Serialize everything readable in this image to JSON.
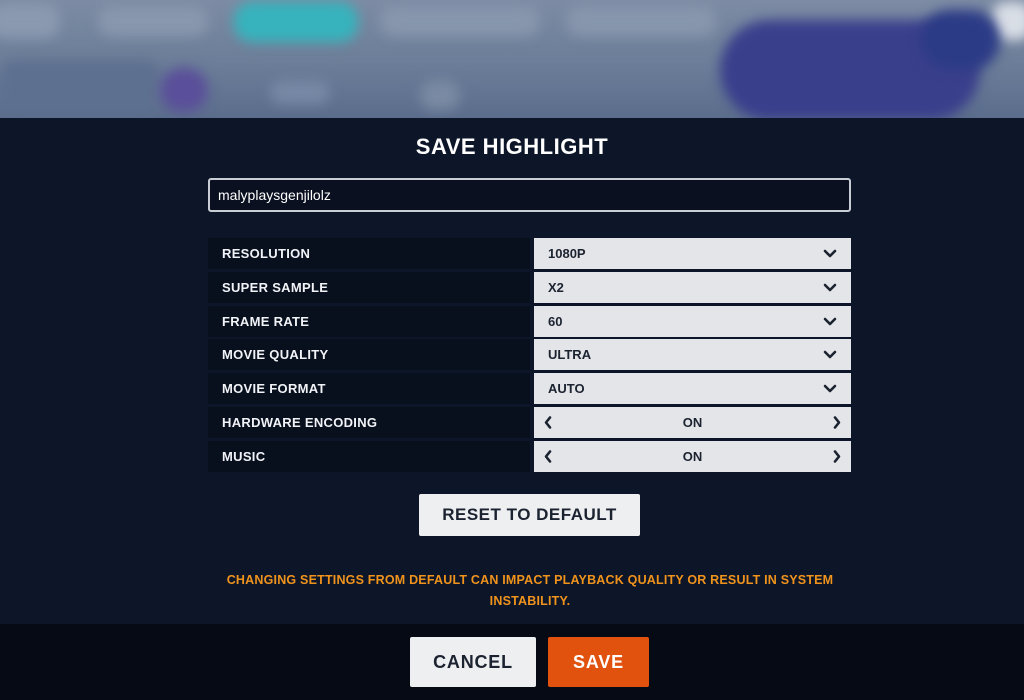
{
  "dialog": {
    "title": "SAVE HIGHLIGHT",
    "name_value": "malyplaysgenjilolz"
  },
  "settings": [
    {
      "label": "RESOLUTION",
      "value": "1080P",
      "control": "dropdown"
    },
    {
      "label": "SUPER SAMPLE",
      "value": "X2",
      "control": "dropdown"
    },
    {
      "label": "FRAME RATE",
      "value": "60",
      "control": "dropdown"
    },
    {
      "label": "MOVIE QUALITY",
      "value": "ULTRA",
      "control": "dropdown"
    },
    {
      "label": "MOVIE FORMAT",
      "value": "AUTO",
      "control": "dropdown"
    },
    {
      "label": "HARDWARE ENCODING",
      "value": "ON",
      "control": "toggle"
    },
    {
      "label": "MUSIC",
      "value": "ON",
      "control": "toggle"
    }
  ],
  "buttons": {
    "reset": "RESET TO DEFAULT",
    "cancel": "CANCEL",
    "save": "SAVE"
  },
  "warning": {
    "line1": "CHANGING SETTINGS FROM DEFAULT CAN IMPACT PLAYBACK QUALITY OR RESULT IN SYSTEM",
    "line2": "INSTABILITY."
  },
  "icons": {
    "dropdown": "chevron-down-icon",
    "toggle_prev": "chevron-left-icon",
    "toggle_next": "chevron-right-icon"
  },
  "colors": {
    "accent": "#e2520f",
    "warning": "#f0931d",
    "panel": "#0d1628",
    "footer": "#050a14",
    "row_label_bg": "#080f1d",
    "control_bg": "#e4e5e8"
  }
}
